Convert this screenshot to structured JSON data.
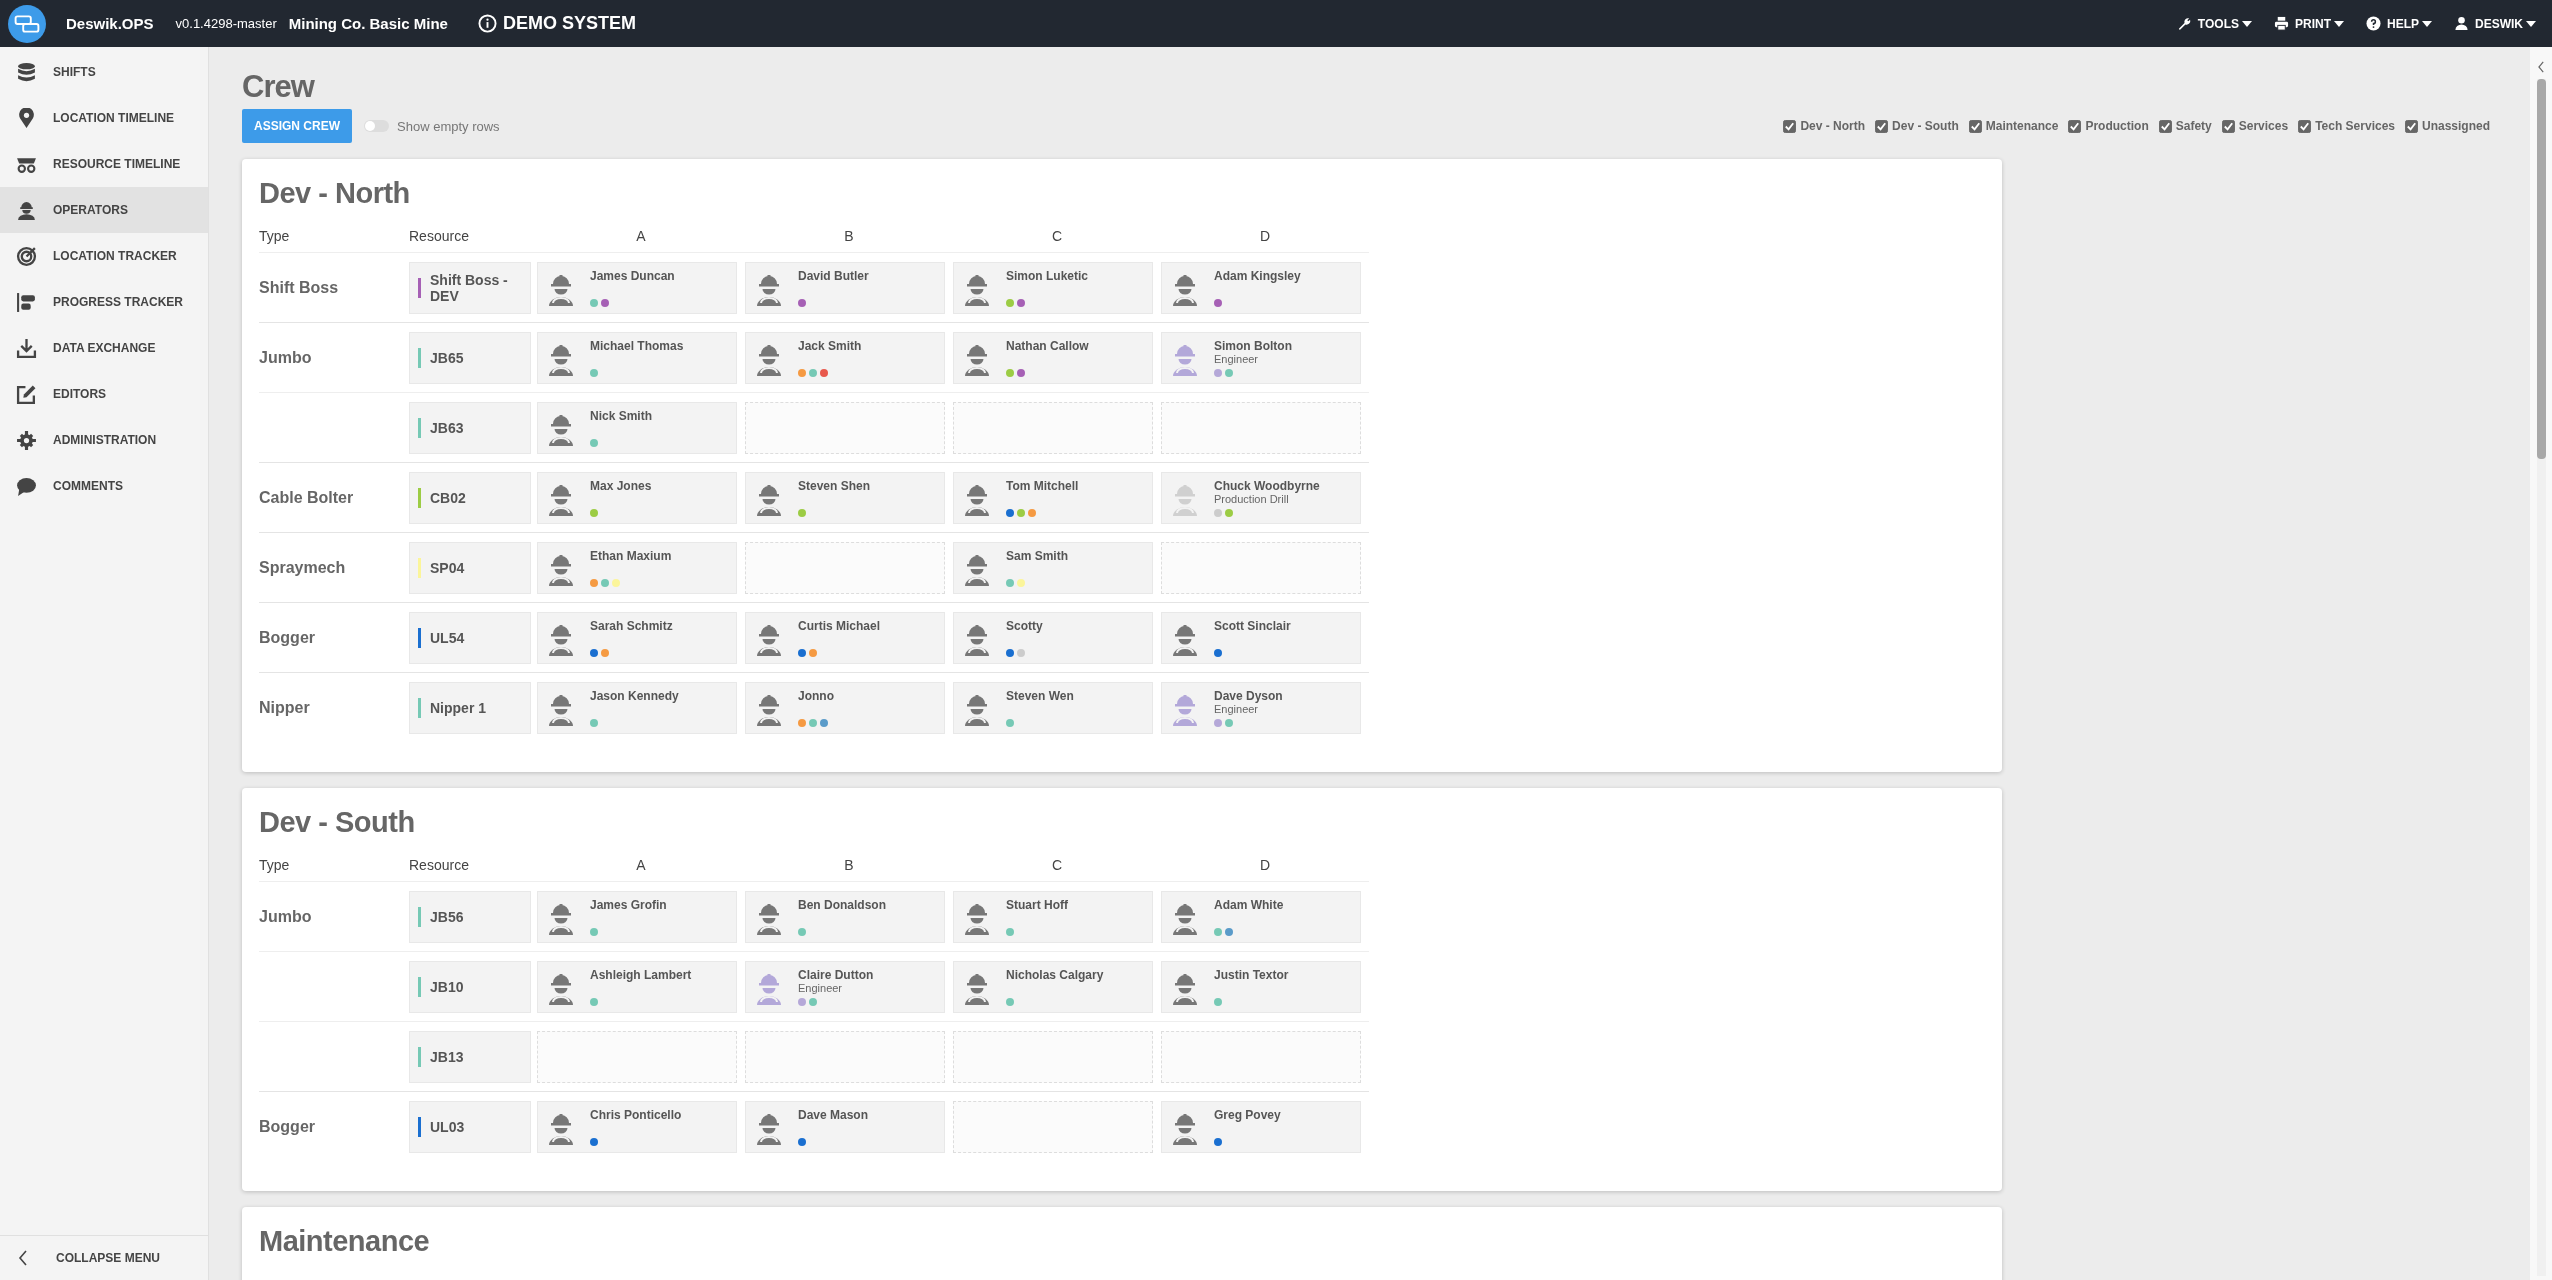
{
  "topbar": {
    "app_name": "Deswik.OPS",
    "version": "v0.1.4298-master",
    "site": "Mining Co. Basic Mine",
    "notice": "DEMO SYSTEM",
    "menus": [
      {
        "kind": "tools",
        "label": "TOOLS"
      },
      {
        "kind": "print",
        "label": "PRINT"
      },
      {
        "kind": "help",
        "label": "HELP"
      },
      {
        "kind": "user",
        "label": "DESWIK"
      }
    ]
  },
  "sidebar": {
    "items": [
      {
        "kind": "shifts",
        "label": "SHIFTS",
        "selected": false
      },
      {
        "kind": "location",
        "label": "LOCATION TIMELINE",
        "selected": false
      },
      {
        "kind": "resource",
        "label": "RESOURCE TIMELINE",
        "selected": false
      },
      {
        "kind": "operators",
        "label": "OPERATORS",
        "selected": true
      },
      {
        "kind": "tracker",
        "label": "LOCATION TRACKER",
        "selected": false
      },
      {
        "kind": "progress",
        "label": "PROGRESS TRACKER",
        "selected": false
      },
      {
        "kind": "exchange",
        "label": "DATA EXCHANGE",
        "selected": false
      },
      {
        "kind": "editors",
        "label": "EDITORS",
        "selected": false
      },
      {
        "kind": "admin",
        "label": "ADMINISTRATION",
        "selected": false
      },
      {
        "kind": "comments",
        "label": "COMMENTS",
        "selected": false
      }
    ],
    "collapse": "COLLAPSE MENU"
  },
  "page": {
    "title": "Crew",
    "assign_button": "ASSIGN CREW",
    "show_empty_rows": {
      "label": "Show empty rows",
      "on": false
    },
    "filters": [
      {
        "label": "Dev - North",
        "checked": true
      },
      {
        "label": "Dev - South",
        "checked": true
      },
      {
        "label": "Maintenance",
        "checked": true
      },
      {
        "label": "Production",
        "checked": true
      },
      {
        "label": "Safety",
        "checked": true
      },
      {
        "label": "Services",
        "checked": true
      },
      {
        "label": "Tech Services",
        "checked": true
      },
      {
        "label": "Unassigned",
        "checked": true
      }
    ]
  },
  "sections": [
    {
      "title": "Dev - North",
      "headers": {
        "type": "Type",
        "resource": "Resource",
        "shifts": [
          "A",
          "B",
          "C",
          "D"
        ]
      },
      "groups": [
        {
          "type": "Shift Boss",
          "rows": [
            {
              "resource": "Shift Boss - DEV",
              "color": "#a660b5",
              "cells": [
                {
                  "kind": "operator",
                  "name": "James Duncan",
                  "dots": [
                    {
                      "color": "#76c9b5"
                    },
                    {
                      "color": "#a660b5"
                    }
                  ]
                },
                {
                  "kind": "operator",
                  "name": "David Butler",
                  "dots": [
                    {
                      "color": "#a660b5"
                    }
                  ]
                },
                {
                  "kind": "operator",
                  "name": "Simon Luketic",
                  "dots": [
                    {
                      "color": "#9ccc44"
                    },
                    {
                      "color": "#a660b5"
                    }
                  ]
                },
                {
                  "kind": "operator",
                  "name": "Adam Kingsley",
                  "dots": [
                    {
                      "color": "#a660b5"
                    }
                  ]
                }
              ]
            }
          ]
        },
        {
          "type": "Jumbo",
          "rows": [
            {
              "resource": "JB65",
              "color": "#76c9b5",
              "cells": [
                {
                  "kind": "operator",
                  "name": "Michael Thomas",
                  "dots": [
                    {
                      "color": "#76c9b5"
                    }
                  ]
                },
                {
                  "kind": "operator",
                  "name": "Jack Smith",
                  "dots": [
                    {
                      "color": "#f59a42"
                    },
                    {
                      "color": "#76c9b5"
                    },
                    {
                      "color": "#e8584c"
                    }
                  ]
                },
                {
                  "kind": "operator",
                  "name": "Nathan Callow",
                  "dots": [
                    {
                      "color": "#9ccc44"
                    },
                    {
                      "color": "#a660b5"
                    }
                  ]
                },
                {
                  "kind": "engineer",
                  "name": "Simon Bolton",
                  "role": "Engineer",
                  "dots": [
                    {
                      "color": "#b5a8d8"
                    },
                    {
                      "color": "#76c9b5"
                    }
                  ]
                }
              ]
            },
            {
              "resource": "JB63",
              "color": "#76c9b5",
              "cells": [
                {
                  "kind": "operator",
                  "name": "Nick Smith",
                  "dots": [
                    {
                      "color": "#76c9b5"
                    }
                  ]
                },
                {
                  "kind": "empty"
                },
                {
                  "kind": "empty"
                },
                {
                  "kind": "empty"
                }
              ]
            }
          ]
        },
        {
          "type": "Cable Bolter",
          "rows": [
            {
              "resource": "CB02",
              "color": "#9ccc44",
              "cells": [
                {
                  "kind": "operator",
                  "name": "Max Jones",
                  "dots": [
                    {
                      "color": "#9ccc44"
                    }
                  ]
                },
                {
                  "kind": "operator",
                  "name": "Steven Shen",
                  "dots": [
                    {
                      "color": "#9ccc44"
                    }
                  ]
                },
                {
                  "kind": "operator",
                  "name": "Tom Mitchell",
                  "dots": [
                    {
                      "color": "#1a6fd0"
                    },
                    {
                      "color": "#9ccc44"
                    },
                    {
                      "color": "#f59a42"
                    }
                  ]
                },
                {
                  "kind": "inactive",
                  "name": "Chuck Woodbyrne",
                  "role": "Production Drill",
                  "dots": [
                    {
                      "color": "#cccccc"
                    },
                    {
                      "color": "#9ccc44"
                    }
                  ]
                }
              ]
            }
          ]
        },
        {
          "type": "Spraymech",
          "rows": [
            {
              "resource": "SP04",
              "color": "#fbf59a",
              "cells": [
                {
                  "kind": "operator",
                  "name": "Ethan Maxium",
                  "dots": [
                    {
                      "color": "#f59a42"
                    },
                    {
                      "color": "#76c9b5"
                    },
                    {
                      "color": "#fbf59a"
                    }
                  ]
                },
                {
                  "kind": "empty"
                },
                {
                  "kind": "operator",
                  "name": "Sam Smith",
                  "dots": [
                    {
                      "color": "#76c9b5"
                    },
                    {
                      "color": "#fbf59a"
                    }
                  ]
                },
                {
                  "kind": "empty"
                }
              ]
            }
          ]
        },
        {
          "type": "Bogger",
          "rows": [
            {
              "resource": "UL54",
              "color": "#1a6fd0",
              "cells": [
                {
                  "kind": "operator",
                  "name": "Sarah Schmitz",
                  "dots": [
                    {
                      "color": "#1a6fd0"
                    },
                    {
                      "color": "#f59a42"
                    }
                  ]
                },
                {
                  "kind": "operator",
                  "name": "Curtis Michael",
                  "dots": [
                    {
                      "color": "#1a6fd0"
                    },
                    {
                      "color": "#f59a42"
                    }
                  ]
                },
                {
                  "kind": "operator",
                  "name": "Scotty",
                  "dots": [
                    {
                      "color": "#1a6fd0"
                    },
                    {
                      "color": "#cccccc"
                    }
                  ]
                },
                {
                  "kind": "operator",
                  "name": "Scott Sinclair",
                  "dots": [
                    {
                      "color": "#1a6fd0"
                    }
                  ]
                }
              ]
            }
          ]
        },
        {
          "type": "Nipper",
          "rows": [
            {
              "resource": "Nipper 1",
              "color": "#76c9b5",
              "cells": [
                {
                  "kind": "operator",
                  "name": "Jason Kennedy",
                  "dots": [
                    {
                      "color": "#76c9b5"
                    }
                  ]
                },
                {
                  "kind": "operator",
                  "name": "Jonno",
                  "dots": [
                    {
                      "color": "#f59a42"
                    },
                    {
                      "color": "#76c9b5"
                    },
                    {
                      "color": "#5a9bc9"
                    }
                  ]
                },
                {
                  "kind": "operator",
                  "name": "Steven Wen",
                  "dots": [
                    {
                      "color": "#76c9b5"
                    }
                  ]
                },
                {
                  "kind": "engineer",
                  "name": "Dave Dyson",
                  "role": "Engineer",
                  "dots": [
                    {
                      "color": "#b5a8d8"
                    },
                    {
                      "color": "#76c9b5"
                    }
                  ]
                }
              ]
            }
          ]
        }
      ]
    },
    {
      "title": "Dev - South",
      "headers": {
        "type": "Type",
        "resource": "Resource",
        "shifts": [
          "A",
          "B",
          "C",
          "D"
        ]
      },
      "groups": [
        {
          "type": "Jumbo",
          "rows": [
            {
              "resource": "JB56",
              "color": "#76c9b5",
              "cells": [
                {
                  "kind": "operator",
                  "name": "James Grofin",
                  "dots": [
                    {
                      "color": "#76c9b5"
                    }
                  ]
                },
                {
                  "kind": "operator",
                  "name": "Ben Donaldson",
                  "dots": [
                    {
                      "color": "#76c9b5"
                    }
                  ]
                },
                {
                  "kind": "operator",
                  "name": "Stuart Hoff",
                  "dots": [
                    {
                      "color": "#76c9b5"
                    }
                  ]
                },
                {
                  "kind": "operator",
                  "name": "Adam White",
                  "dots": [
                    {
                      "color": "#76c9b5"
                    },
                    {
                      "color": "#5a9bc9"
                    }
                  ]
                }
              ]
            },
            {
              "resource": "JB10",
              "color": "#76c9b5",
              "cells": [
                {
                  "kind": "operator",
                  "name": "Ashleigh Lambert",
                  "dots": [
                    {
                      "color": "#76c9b5"
                    }
                  ]
                },
                {
                  "kind": "engineer",
                  "name": "Claire Dutton",
                  "role": "Engineer",
                  "dots": [
                    {
                      "color": "#b5a8d8"
                    },
                    {
                      "color": "#76c9b5"
                    }
                  ]
                },
                {
                  "kind": "operator",
                  "name": "Nicholas Calgary",
                  "dots": [
                    {
                      "color": "#76c9b5"
                    }
                  ]
                },
                {
                  "kind": "operator",
                  "name": "Justin Textor",
                  "dots": [
                    {
                      "color": "#76c9b5"
                    }
                  ]
                }
              ]
            },
            {
              "resource": "JB13",
              "color": "#76c9b5",
              "cells": [
                {
                  "kind": "empty"
                },
                {
                  "kind": "empty"
                },
                {
                  "kind": "empty"
                },
                {
                  "kind": "empty"
                }
              ]
            }
          ]
        },
        {
          "type": "Bogger",
          "rows": [
            {
              "resource": "UL03",
              "color": "#1a6fd0",
              "cells": [
                {
                  "kind": "operator",
                  "name": "Chris Ponticello",
                  "dots": [
                    {
                      "color": "#1a6fd0"
                    }
                  ]
                },
                {
                  "kind": "operator",
                  "name": "Dave Mason",
                  "dots": [
                    {
                      "color": "#1a6fd0"
                    }
                  ]
                },
                {
                  "kind": "empty"
                },
                {
                  "kind": "operator",
                  "name": "Greg Povey",
                  "dots": [
                    {
                      "color": "#1a6fd0"
                    }
                  ]
                }
              ]
            }
          ]
        }
      ]
    },
    {
      "title": "Maintenance"
    }
  ]
}
